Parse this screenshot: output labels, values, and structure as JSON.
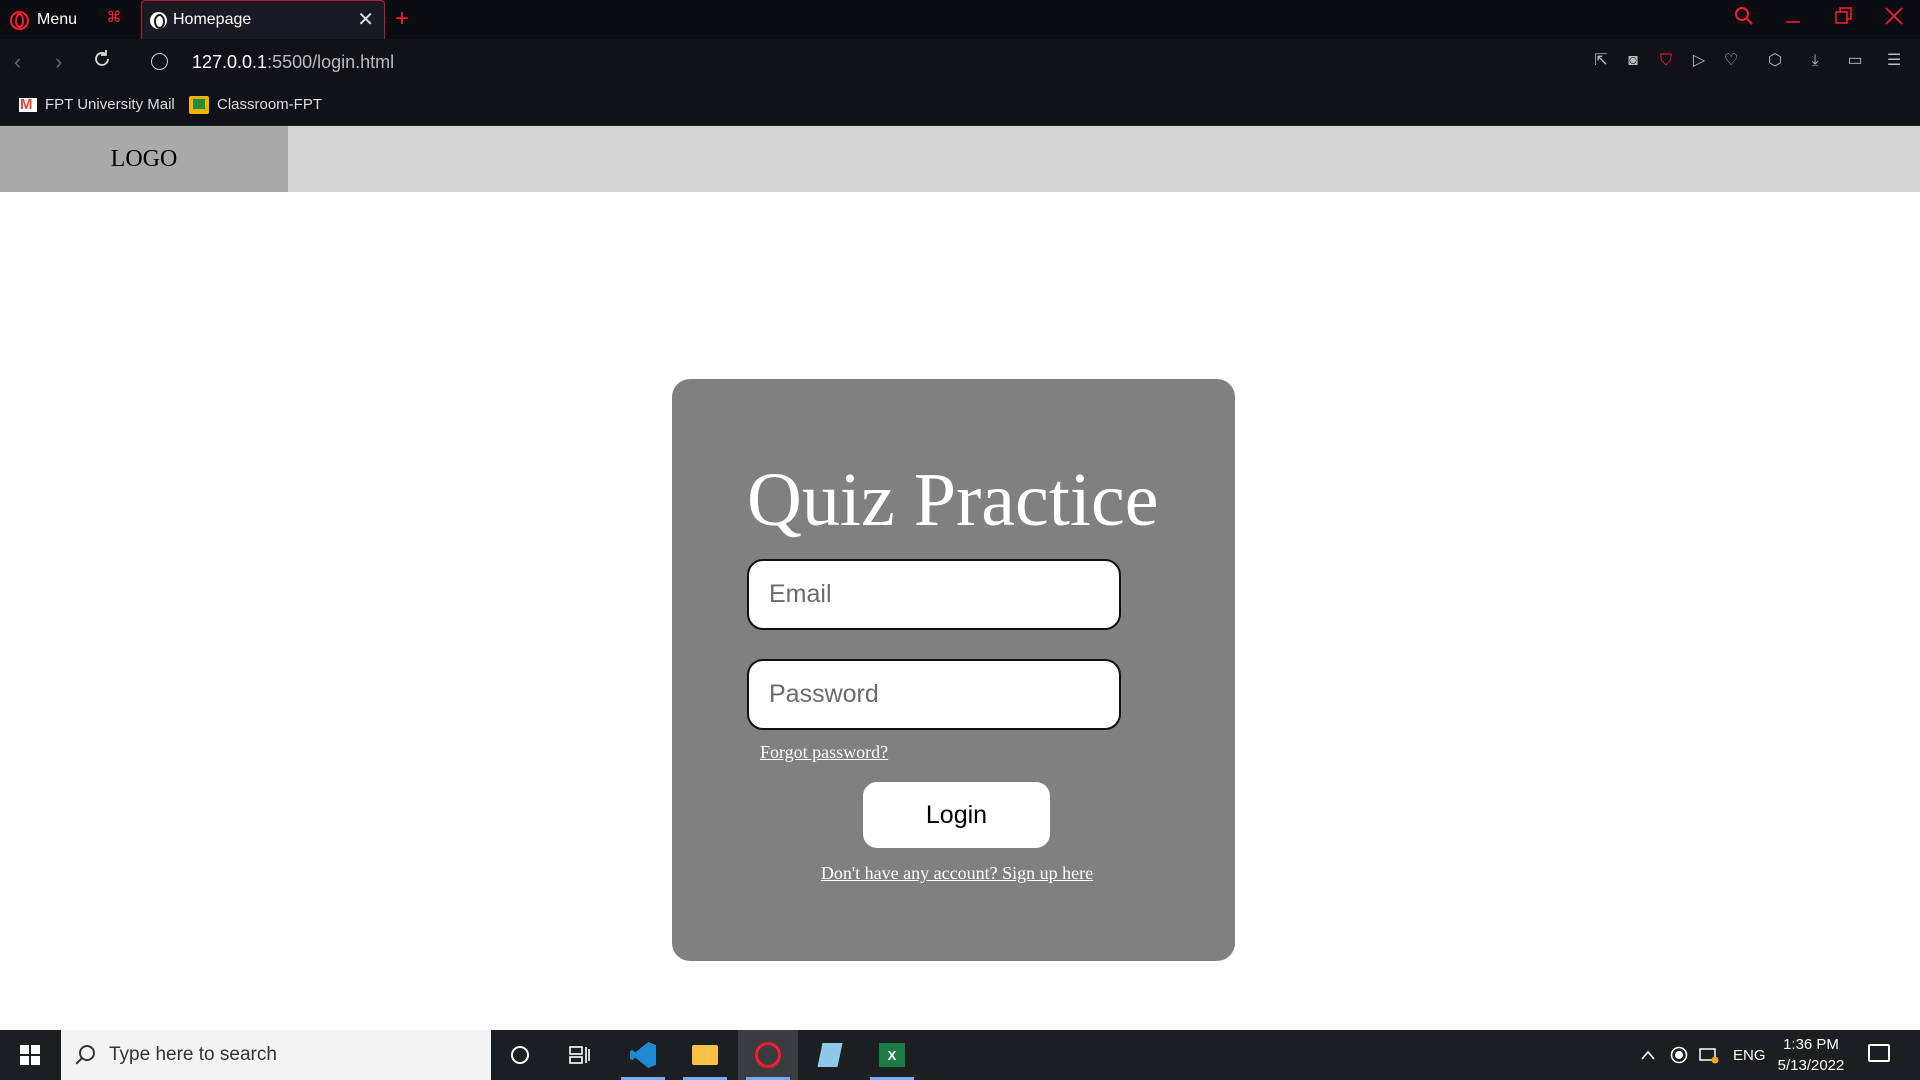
{
  "browser": {
    "menu_label": "Menu",
    "tab_title": "Homepage",
    "tab_close": "✕",
    "new_tab": "+",
    "url_host": "127.0.0.1",
    "url_path": ":5500/login.html",
    "bookmarks": [
      {
        "label": "FPT University Mail",
        "icon": "gmail-icon"
      },
      {
        "label": "Classroom-FPT",
        "icon": "google-classroom-icon"
      }
    ],
    "accent_color": "#ff1b2d"
  },
  "header": {
    "logo": "LOGO"
  },
  "login": {
    "title": "Quiz Practice",
    "email_placeholder": "Email",
    "password_placeholder": "Password",
    "forgot_link": "Forgot password?",
    "login_button": "Login",
    "signup_link": "Don't have any account? Sign up here"
  },
  "taskbar": {
    "search_placeholder": "Type here to search",
    "language": "ENG",
    "time": "1:36 PM",
    "date": "5/13/2022"
  }
}
